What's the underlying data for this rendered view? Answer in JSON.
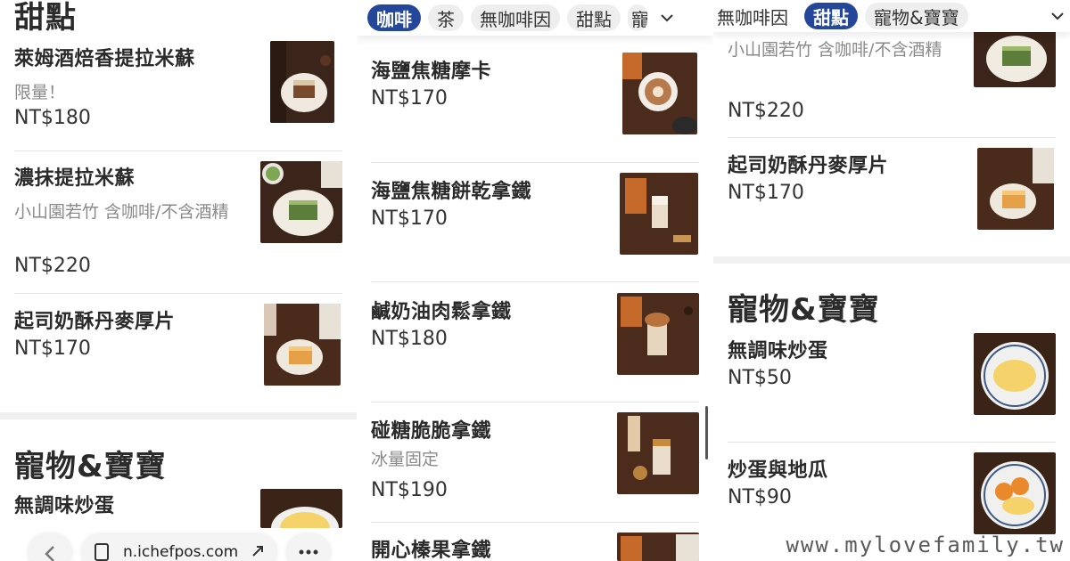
{
  "left": {
    "section_dessert": "甜點",
    "section_pet": "寵物&寶寶",
    "items": [
      {
        "name": "萊姆酒焙香提拉米蘇",
        "desc": "限量！",
        "price": "NT$180"
      },
      {
        "name": "濃抹提拉米蘇",
        "desc": "小山園若竹 含咖啡/不含酒精",
        "price": "NT$220"
      },
      {
        "name": "起司奶酥丹麥厚片",
        "desc": "",
        "price": "NT$170"
      },
      {
        "name": "無調味炒蛋",
        "desc": "",
        "price": ""
      }
    ],
    "bottom_bar": {
      "url": "n.ichefpos.com"
    }
  },
  "middle": {
    "chips": [
      {
        "label": "咖啡",
        "active": true
      },
      {
        "label": "茶",
        "active": false
      },
      {
        "label": "無咖啡因",
        "active": false
      },
      {
        "label": "甜點",
        "active": false
      },
      {
        "label": "寵",
        "active": false
      }
    ],
    "items": [
      {
        "name": "海鹽焦糖摩卡",
        "desc": "",
        "price": "NT$170"
      },
      {
        "name": "海鹽焦糖餅乾拿鐵",
        "desc": "",
        "price": "NT$170"
      },
      {
        "name": "鹹奶油肉鬆拿鐵",
        "desc": "",
        "price": "NT$180"
      },
      {
        "name": "碰糖脆脆拿鐵",
        "desc": "冰量固定",
        "price": "NT$190"
      },
      {
        "name": "開心榛果拿鐵",
        "desc": "",
        "price": ""
      }
    ]
  },
  "right": {
    "chips": [
      {
        "label": "無咖啡因",
        "active": false
      },
      {
        "label": "甜點",
        "active": true
      },
      {
        "label": "寵物&寶寶",
        "active": false
      }
    ],
    "section_pet": "寵物&寶寶",
    "items": [
      {
        "name": "",
        "desc": "小山園若竹 含咖啡/不含酒精",
        "price": "NT$220"
      },
      {
        "name": "起司奶酥丹麥厚片",
        "desc": "",
        "price": "NT$170"
      },
      {
        "name": "無調味炒蛋",
        "desc": "",
        "price": "NT$50"
      },
      {
        "name": "炒蛋與地瓜",
        "desc": "",
        "price": "NT$90"
      }
    ]
  },
  "watermark": "www.mylovefamily.tw",
  "colors": {
    "chip_active": "#25479a",
    "chip_inactive": "#eeeeee",
    "text_main": "#2a2a2a",
    "text_muted": "#8a8a8a"
  }
}
